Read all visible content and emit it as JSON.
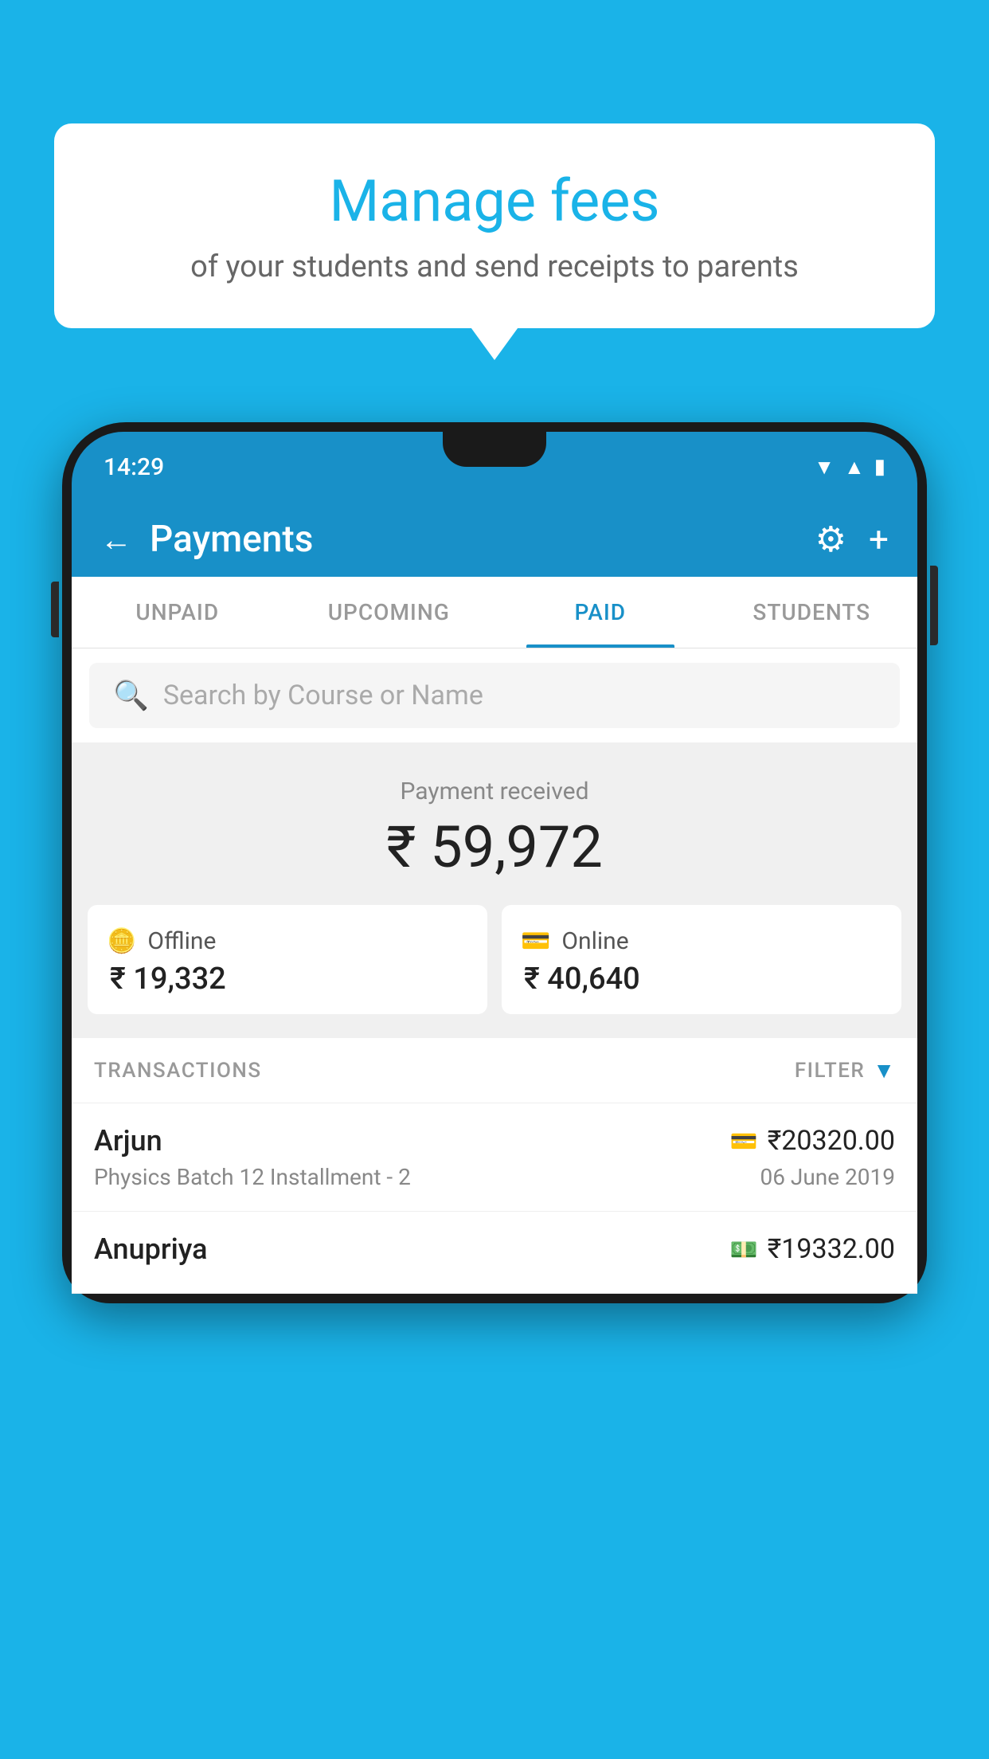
{
  "background": {
    "color": "#1ab3e8"
  },
  "speech_bubble": {
    "title": "Manage fees",
    "subtitle": "of your students and send receipts to parents"
  },
  "phone": {
    "status_bar": {
      "time": "14:29",
      "icons": [
        "wifi",
        "signal",
        "battery"
      ]
    },
    "header": {
      "title": "Payments",
      "back_label": "←",
      "settings_icon": "⚙",
      "add_icon": "+"
    },
    "tabs": [
      {
        "label": "UNPAID",
        "active": false
      },
      {
        "label": "UPCOMING",
        "active": false
      },
      {
        "label": "PAID",
        "active": true
      },
      {
        "label": "STUDENTS",
        "active": false
      }
    ],
    "search": {
      "placeholder": "Search by Course or Name"
    },
    "payment_received": {
      "label": "Payment received",
      "amount": "₹ 59,972"
    },
    "payment_cards": [
      {
        "type": "Offline",
        "amount": "₹ 19,332",
        "icon": "💵"
      },
      {
        "type": "Online",
        "amount": "₹ 40,640",
        "icon": "💳"
      }
    ],
    "transactions_section": {
      "label": "TRANSACTIONS",
      "filter_label": "FILTER",
      "transactions": [
        {
          "name": "Arjun",
          "amount": "₹20320.00",
          "course": "Physics Batch 12 Installment - 2",
          "date": "06 June 2019",
          "payment_type_icon": "💳"
        },
        {
          "name": "Anupriya",
          "amount": "₹19332.00",
          "course": "",
          "date": "",
          "payment_type_icon": "💵"
        }
      ]
    }
  }
}
